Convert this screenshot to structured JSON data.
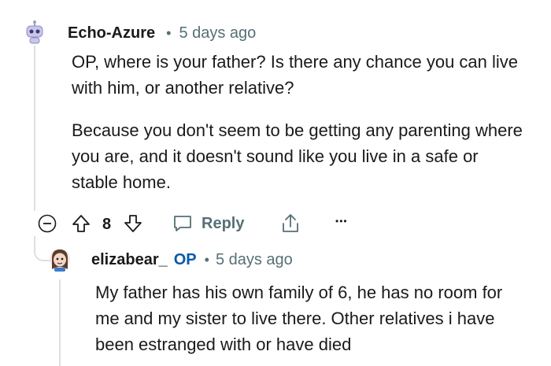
{
  "comment": {
    "author": "Echo-Azure",
    "separator": "•",
    "time": "5 days ago",
    "paragraphs": [
      "OP, where is your father? Is there any chance you can live with him, or another relative?",
      "Because you don't seem to be getting any parenting where you are, and it doesn't sound like you live in a safe or stable home."
    ],
    "actions": {
      "score": "8",
      "reply_label": "Reply",
      "more_label": "•••"
    },
    "avatar_icon": "robot-avatar-icon"
  },
  "reply": {
    "author": "elizabear_",
    "op_badge": "OP",
    "separator": "•",
    "time": "5 days ago",
    "paragraphs": [
      "My father has his own family of 6, he has no room for me and my sister to live there. Other relatives i have been estranged with or have died"
    ],
    "avatar_icon": "snoo-avatar-icon"
  },
  "colors": {
    "text": "#1a1a1b",
    "meta": "#576f76",
    "op": "#0a5aa8",
    "thread_line": "#dcdfe2"
  }
}
